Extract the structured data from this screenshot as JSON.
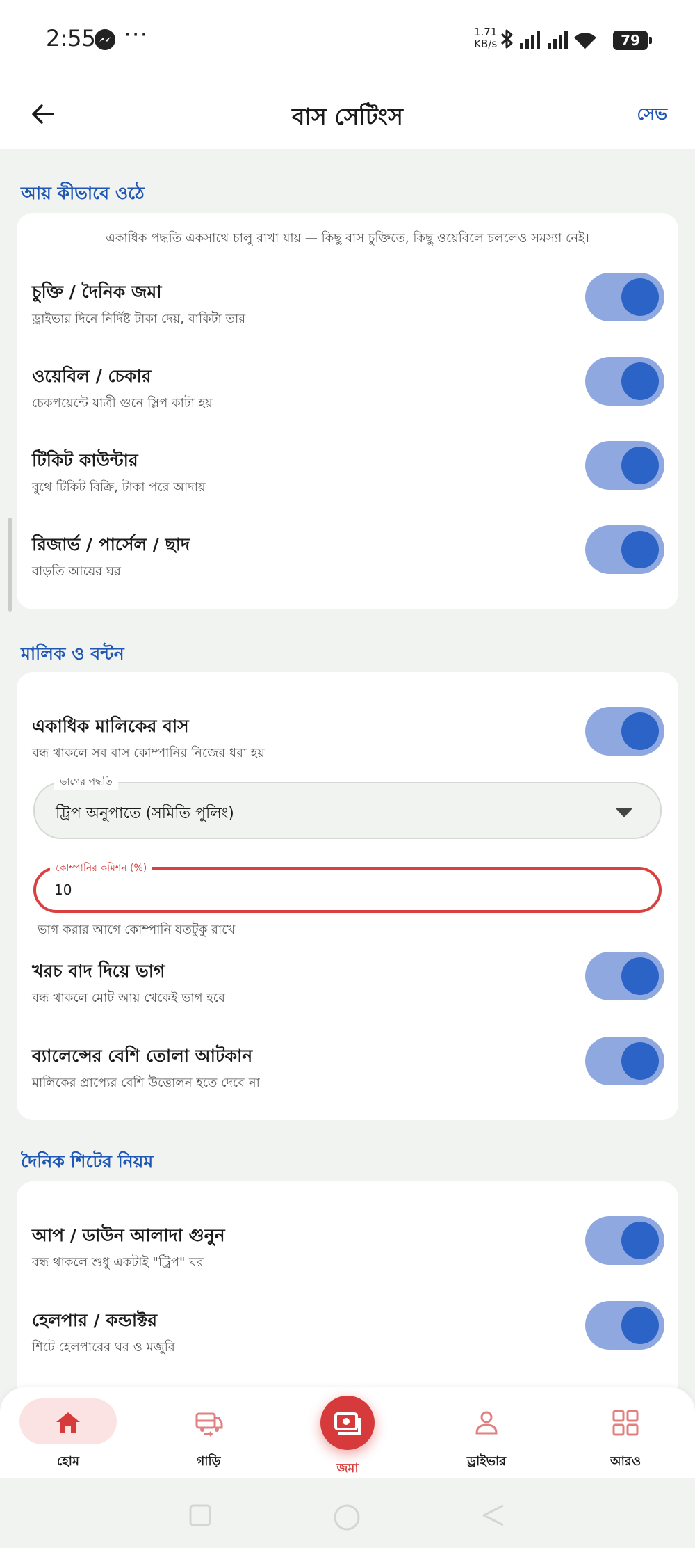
{
  "status_bar": {
    "time": "2:55",
    "speed_value": "1.71",
    "speed_unit": "KB/s",
    "battery": "79"
  },
  "app_bar": {
    "title": "বাস সেটিংস",
    "save_label": "সেভ"
  },
  "sections": {
    "income": {
      "title": "আয় কীভাবে ওঠে",
      "note": "একাধিক পদ্ধতি একসাথে চালু রাখা যায় — কিছু বাস চুক্তিতে, কিছু ওয়েবিলে চললেও সমস্যা নেই।",
      "items": [
        {
          "title": "চুক্তি / দৈনিক জমা",
          "subtitle": "ড্রাইভার দিনে নির্দিষ্ট টাকা দেয়, বাকিটা তার",
          "enabled": true
        },
        {
          "title": "ওয়েবিল / চেকার",
          "subtitle": "চেকপয়েন্টে যাত্রী গুনে স্লিপ কাটা হয়",
          "enabled": true
        },
        {
          "title": "টিকিট কাউন্টার",
          "subtitle": "বুথে টিকিট বিক্রি, টাকা পরে আদায়",
          "enabled": true
        },
        {
          "title": "রিজার্ভ / পার্সেল / ছাদ",
          "subtitle": "বাড়তি আয়ের ঘর",
          "enabled": true
        }
      ]
    },
    "owner": {
      "title": "মালিক ও বন্টন",
      "multi_owner": {
        "title": "একাধিক মালিকের বাস",
        "subtitle": "বন্ধ থাকলে সব বাস কোম্পানির নিজের ধরা হয়",
        "enabled": true
      },
      "split_method": {
        "label": "ভাগের পদ্ধতি",
        "value": "ট্রিপ অনুপাতে (সমিতি পুলিং)"
      },
      "commission": {
        "label": "কোম্পানির কমিশন (%)",
        "value": "10",
        "helper": "ভাগ করার আগে কোম্পানি যতটুকু রাখে"
      },
      "items": [
        {
          "title": "খরচ বাদ দিয়ে ভাগ",
          "subtitle": "বন্ধ থাকলে মোট আয় থেকেই ভাগ হবে",
          "enabled": true
        },
        {
          "title": "ব্যালেন্সের বেশি তোলা আটকান",
          "subtitle": "মালিকের প্রাপ্যের বেশি উত্তোলন হতে দেবে না",
          "enabled": true
        }
      ]
    },
    "daily": {
      "title": "দৈনিক শিটের নিয়ম",
      "items": [
        {
          "title": "আপ / ডাউন আলাদা গুনুন",
          "subtitle": "বন্ধ থাকলে শুধু একটাই \"ট্রিপ\" ঘর",
          "enabled": true
        },
        {
          "title": "হেলপার / কন্ডাক্টর",
          "subtitle": "শিটে হেলপারের ঘর ও মজুরি",
          "enabled": true
        }
      ]
    }
  },
  "bottom_nav": {
    "items": [
      {
        "label": "হোম",
        "icon": "home-icon",
        "active": true
      },
      {
        "label": "গাড়ি",
        "icon": "bus-icon"
      },
      {
        "label": "জমা",
        "icon": "cash-icon"
      },
      {
        "label": "ড্রাইভার",
        "icon": "person-icon"
      },
      {
        "label": "আরও",
        "icon": "grid-icon"
      }
    ]
  },
  "colors": {
    "accent": "#2057b5",
    "toggle_track": "#8fa9e0",
    "toggle_knob": "#2c63c6",
    "error": "#d94040",
    "nav_accent": "#d63a3a"
  }
}
